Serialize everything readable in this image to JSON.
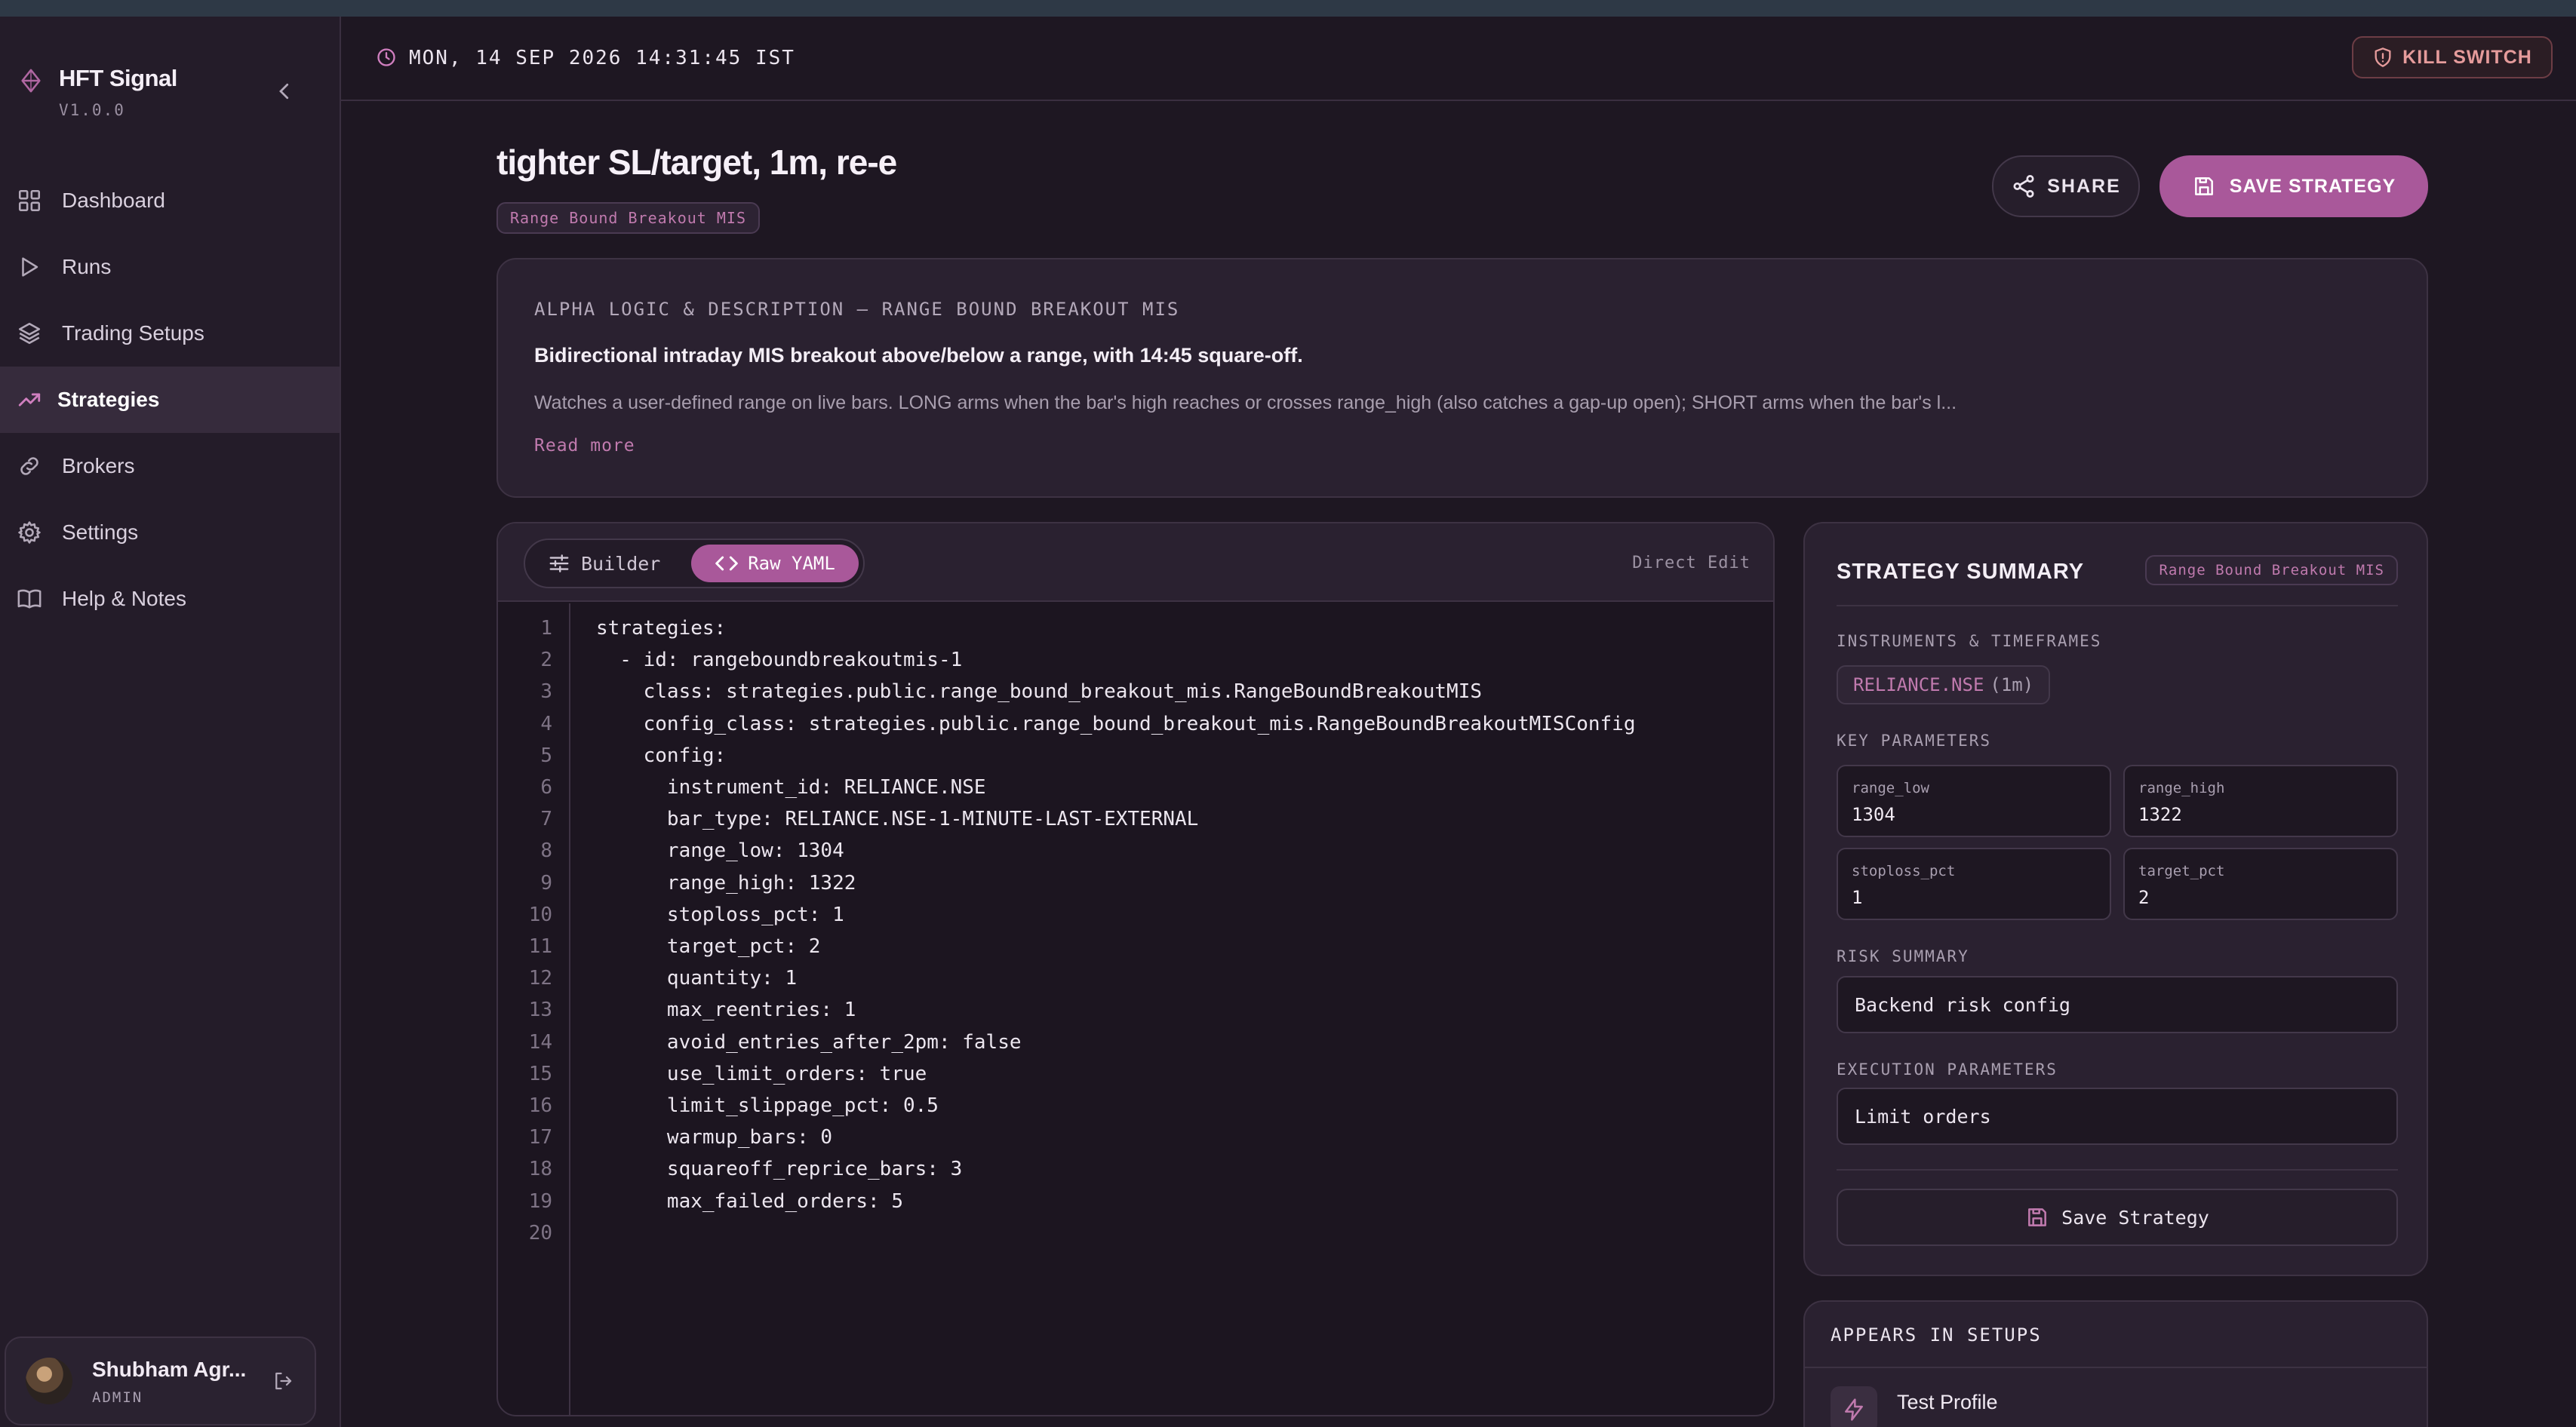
{
  "app": {
    "name": "HFT Signal",
    "version": "V1.0.0"
  },
  "sidebar": {
    "items": [
      {
        "label": "Dashboard",
        "icon": "grid-icon"
      },
      {
        "label": "Runs",
        "icon": "play-icon"
      },
      {
        "label": "Trading Setups",
        "icon": "layers-icon"
      },
      {
        "label": "Strategies",
        "icon": "trending-up-icon",
        "active": true
      },
      {
        "label": "Brokers",
        "icon": "link-icon"
      },
      {
        "label": "Settings",
        "icon": "gear-icon"
      },
      {
        "label": "Help & Notes",
        "icon": "book-icon"
      }
    ],
    "user": {
      "name": "Shubham Agr...",
      "role": "ADMIN"
    }
  },
  "header": {
    "datetime": "MON, 14 SEP 2026 14:31:45 IST",
    "kill_switch_label": "KILL SWITCH"
  },
  "page": {
    "title": "tighter SL/target, 1m, re-e",
    "strategy_tag": "Range Bound Breakout MIS",
    "share_label": "SHARE",
    "save_label": "SAVE STRATEGY"
  },
  "description": {
    "heading": "ALPHA LOGIC & DESCRIPTION — RANGE BOUND BREAKOUT MIS",
    "lead": "Bidirectional intraday MIS breakout above/below a range, with 14:45 square-off.",
    "body": "Watches a user-defined range on live bars. LONG arms when the bar's high reaches or crosses range_high (also catches a gap-up open); SHORT arms when the bar's l...",
    "read_more": "Read more"
  },
  "editor": {
    "builder_label": "Builder",
    "raw_label": "Raw YAML",
    "mode_label": "Direct Edit",
    "lines": [
      "strategies:",
      "  - id: rangeboundbreakoutmis-1",
      "    class: strategies.public.range_bound_breakout_mis.RangeBoundBreakoutMIS",
      "    config_class: strategies.public.range_bound_breakout_mis.RangeBoundBreakoutMISConfig",
      "    config:",
      "      instrument_id: RELIANCE.NSE",
      "      bar_type: RELIANCE.NSE-1-MINUTE-LAST-EXTERNAL",
      "      range_low: 1304",
      "      range_high: 1322",
      "      stoploss_pct: 1",
      "      target_pct: 2",
      "      quantity: 1",
      "      max_reentries: 1",
      "      avoid_entries_after_2pm: false",
      "      use_limit_orders: true",
      "      limit_slippage_pct: 0.5",
      "      warmup_bars: 0",
      "      squareoff_reprice_bars: 3",
      "      max_failed_orders: 5",
      ""
    ]
  },
  "summary": {
    "title": "STRATEGY SUMMARY",
    "tag": "Range Bound Breakout MIS",
    "instruments_label": "INSTRUMENTS & TIMEFRAMES",
    "instrument": "RELIANCE.NSE",
    "timeframe": "(1m)",
    "key_params_label": "KEY PARAMETERS",
    "params": [
      {
        "key": "range_low",
        "value": "1304"
      },
      {
        "key": "range_high",
        "value": "1322"
      },
      {
        "key": "stoploss_pct",
        "value": "1"
      },
      {
        "key": "target_pct",
        "value": "2"
      }
    ],
    "risk_label": "RISK SUMMARY",
    "risk_value": "Backend risk config",
    "exec_label": "EXECUTION PARAMETERS",
    "exec_value": "Limit orders",
    "save_label": "Save Strategy"
  },
  "setups": {
    "title": "APPEARS IN SETUPS",
    "items": [
      {
        "name": "Test Profile"
      }
    ]
  },
  "colors": {
    "accent": "#a9589a",
    "accent_text": "#c07aae",
    "background": "#1e1722",
    "sidebar": "#241c29",
    "danger": "#e59b9b"
  }
}
